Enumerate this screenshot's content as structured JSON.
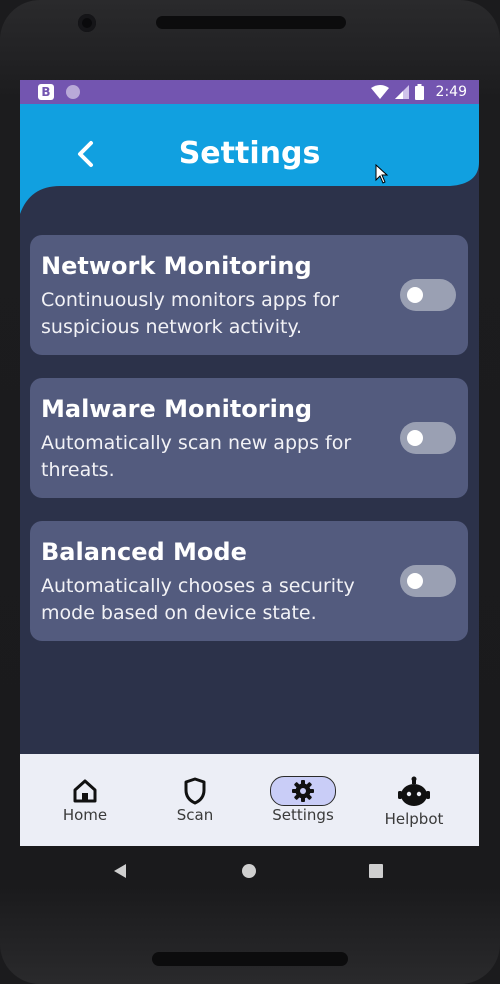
{
  "statusbar": {
    "app_badge": "B",
    "time": "2:49"
  },
  "header": {
    "title": "Settings"
  },
  "settings": [
    {
      "title": "Network Monitoring",
      "description": "Continuously monitors apps for suspicious network activity.",
      "enabled": false
    },
    {
      "title": "Malware Monitoring",
      "description": "Automatically scan new apps for threats.",
      "enabled": false
    },
    {
      "title": "Balanced Mode",
      "description": "Automatically chooses a security mode based on device state.",
      "enabled": false
    }
  ],
  "bottom_nav": {
    "items": [
      {
        "label": "Home",
        "icon": "home-icon"
      },
      {
        "label": "Scan",
        "icon": "shield-icon"
      },
      {
        "label": "Settings",
        "icon": "gear-icon",
        "active": true
      },
      {
        "label": "Helpbot",
        "icon": "robot-icon"
      }
    ]
  },
  "colors": {
    "status_bar": "#7355b0",
    "header": "#11a0e0",
    "background": "#2c324a",
    "card": "#535b7e",
    "nav_bg": "#eceef6",
    "active_pill": "#c9cdf7"
  }
}
